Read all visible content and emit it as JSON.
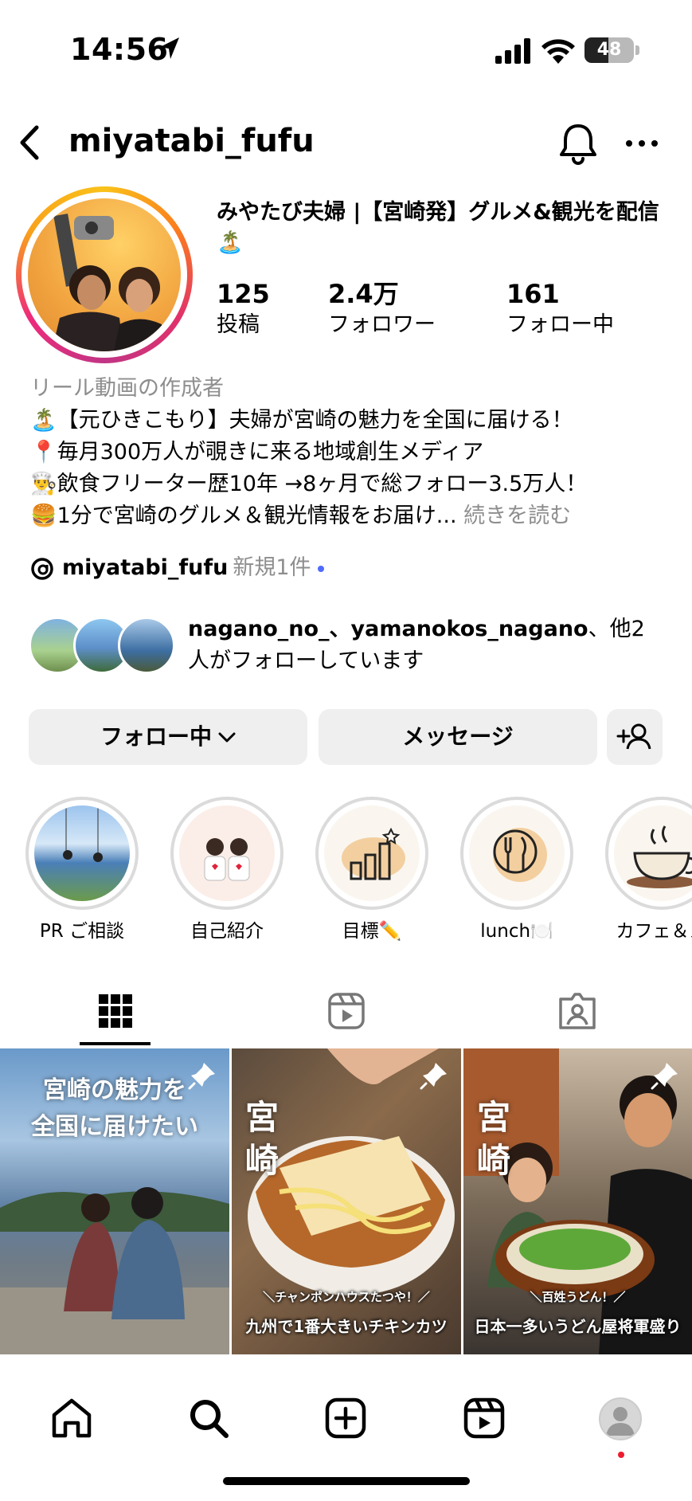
{
  "status_bar": {
    "time": "14:56",
    "battery": "48",
    "battery_level": 0.48
  },
  "header": {
    "username": "miyatabi_fufu"
  },
  "profile": {
    "display_name": "みやたび夫婦 |【宮崎発】グルメ&観光を配信🏝️",
    "stats": [
      {
        "value": "125",
        "label": "投稿"
      },
      {
        "value": "2.4万",
        "label": "フォロワー"
      },
      {
        "value": "161",
        "label": "フォロー中"
      }
    ],
    "category": "リール動画の作成者",
    "bio_lines": [
      "🏝️【元ひきこもり】夫婦が宮崎の魅力を全国に届ける！",
      "📍毎月300万人が覗きに来る地域創生メディア",
      "👨‍🍳飲食フリーター歴10年 →8ヶ月で総フォロー3.5万人！",
      "🍔1分で宮崎のグルメ＆観光情報をお届け..."
    ],
    "more_label": "続きを読む",
    "threads_handle": "miyatabi_fufu",
    "threads_new": "新規1件",
    "mutual_names": "nagano_no_、yamanokos_nagano",
    "mutual_rest": "、他2人がフォローしています"
  },
  "buttons": {
    "following": "フォロー中",
    "message": "メッセージ"
  },
  "highlights": [
    {
      "label": "PR ご相談"
    },
    {
      "label": "自己紹介"
    },
    {
      "label": "目標✏️"
    },
    {
      "label": "lunch🍽️"
    },
    {
      "label": "カフェ＆ス"
    }
  ],
  "posts": [
    {
      "title_line1": "宮崎の魅力を",
      "title_line2": "全国に届けたい"
    },
    {
      "title": "宮崎",
      "sub": "＼チャンポンハウスたつや！／",
      "caption": "九州で1番大きいチキンカツ"
    },
    {
      "title": "宮崎",
      "sub": "＼百姓うどん！／",
      "caption": "日本一多いうどん屋将軍盛り"
    }
  ],
  "colors": {
    "accent_gray": "#8e8e8e",
    "button_bg": "#efefef",
    "notification_red": "#ed1c2e",
    "threads_dot": "#4f6bff"
  }
}
